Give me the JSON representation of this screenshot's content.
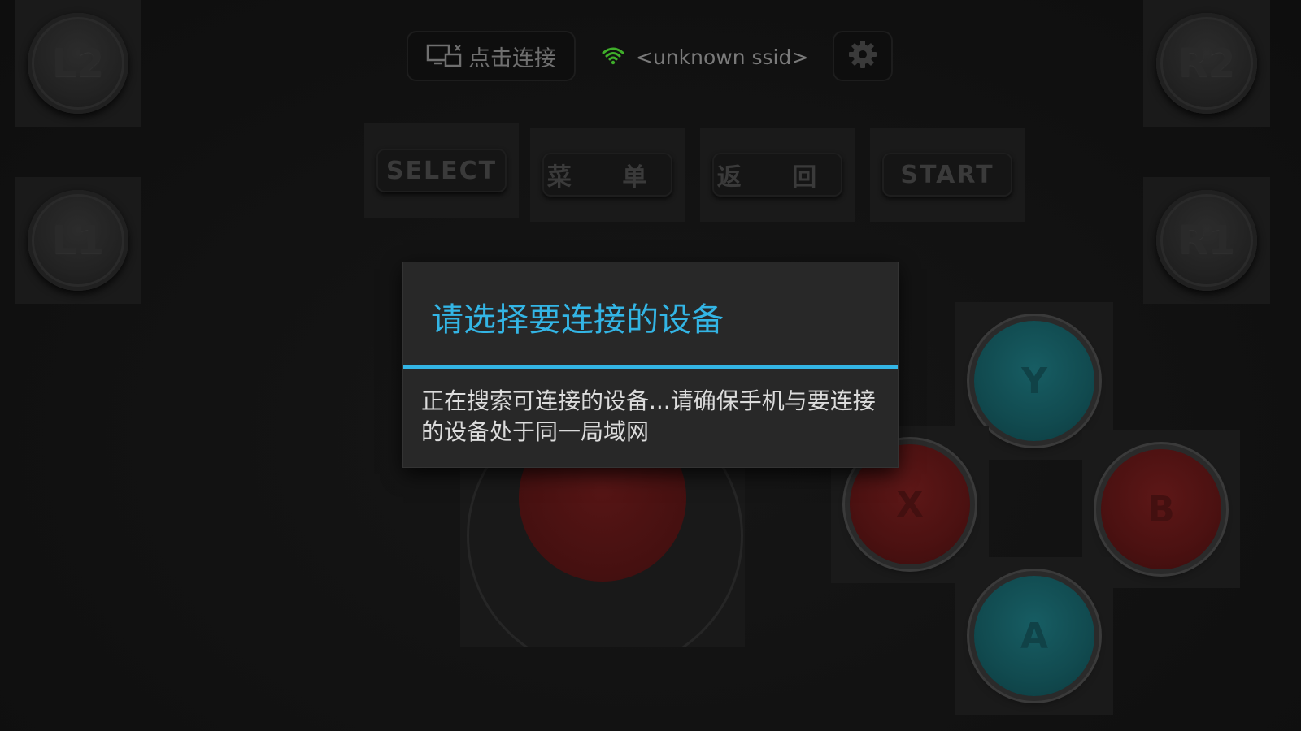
{
  "shoulder_buttons": {
    "l2": "L2",
    "l1": "L1",
    "r2": "R2",
    "r1": "R1"
  },
  "top_bar": {
    "connect_label": "点击连接",
    "ssid": "<unknown ssid>"
  },
  "function_buttons": {
    "select": "SELECT",
    "menu": "菜 单",
    "back": "返 回",
    "start": "START"
  },
  "face_buttons": {
    "y": "Y",
    "x": "X",
    "b": "B",
    "a": "A"
  },
  "dialog": {
    "title": "请选择要连接的设备",
    "message": "正在搜索可连接的设备...请确保手机与要连接的设备处于同一局域网"
  },
  "colors": {
    "accent": "#33b5e5",
    "wifi": "#3fae2a",
    "teal_button": "#114a4f",
    "red_button": "#4b1111"
  }
}
